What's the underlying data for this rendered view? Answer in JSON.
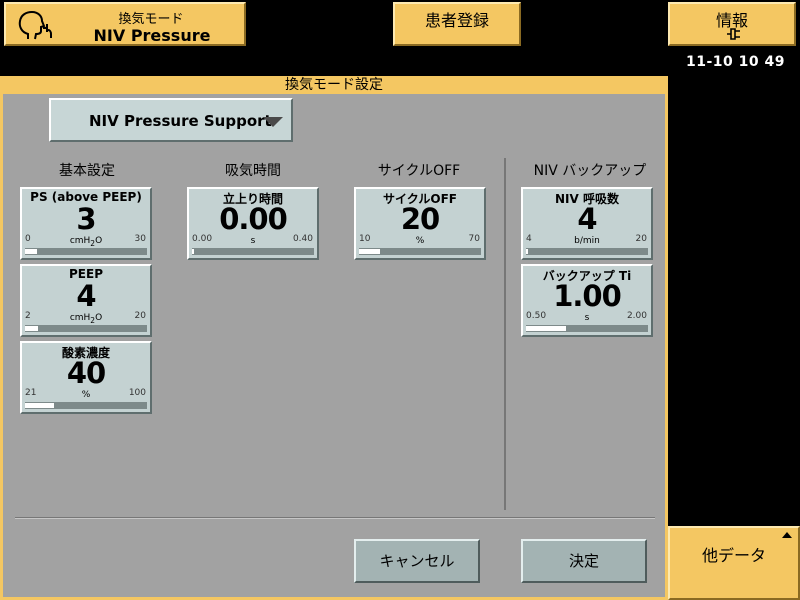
{
  "header": {
    "mode_button": {
      "line1": "換気モード",
      "line2": "NIV Pressure Support",
      "icon": "patient-mask-icon"
    },
    "patient_button": {
      "label": "患者登録"
    },
    "info_button": {
      "label": "情報",
      "icon": "mains-plug-icon"
    },
    "clock": "11-10   10 49"
  },
  "dialog": {
    "title": "換気モード設定",
    "mode_select": {
      "value": "NIV Pressure Support"
    },
    "columns": {
      "basic": "基本設定",
      "inspiration_time": "吸気時間",
      "cycle_off": "サイクルOFF",
      "niv_backup": "NIV バックアップ"
    },
    "params": {
      "ps": {
        "label": "PS (above PEEP)",
        "value": "3",
        "unit_base": "cmH",
        "unit_sub": "2",
        "unit_tail": "O",
        "min": "0",
        "max": "30",
        "level": 0.1
      },
      "peep": {
        "label": "PEEP",
        "value": "4",
        "unit_base": "cmH",
        "unit_sub": "2",
        "unit_tail": "O",
        "min": "2",
        "max": "20",
        "level": 0.11
      },
      "o2": {
        "label": "酸素濃度",
        "value": "40",
        "unit": "%",
        "min": "21",
        "max": "100",
        "level": 0.24
      },
      "rise": {
        "label": "立上り時間",
        "value": "0.00",
        "unit": "s",
        "min": "0.00",
        "max": "0.40",
        "level": 0.0
      },
      "cycle": {
        "label": "サイクルOFF",
        "value": "20",
        "unit": "%",
        "min": "10",
        "max": "70",
        "level": 0.17
      },
      "resp_rate": {
        "label": "NIV 呼吸数",
        "value": "4",
        "unit": "b/min",
        "min": "4",
        "max": "20",
        "level": 0.0
      },
      "backup_ti": {
        "label": "バックアップ Ti",
        "value": "1.00",
        "unit": "s",
        "min": "0.50",
        "max": "2.00",
        "level": 0.33
      }
    },
    "cancel_label": "キャンセル",
    "confirm_label": "決定"
  },
  "side": {
    "other_data_label": "他データ"
  },
  "colors": {
    "accent": "#f4c762",
    "panel": "#a2a2a2",
    "card": "#c4d2d2",
    "button": "#a3b3b3",
    "background": "#000000"
  }
}
